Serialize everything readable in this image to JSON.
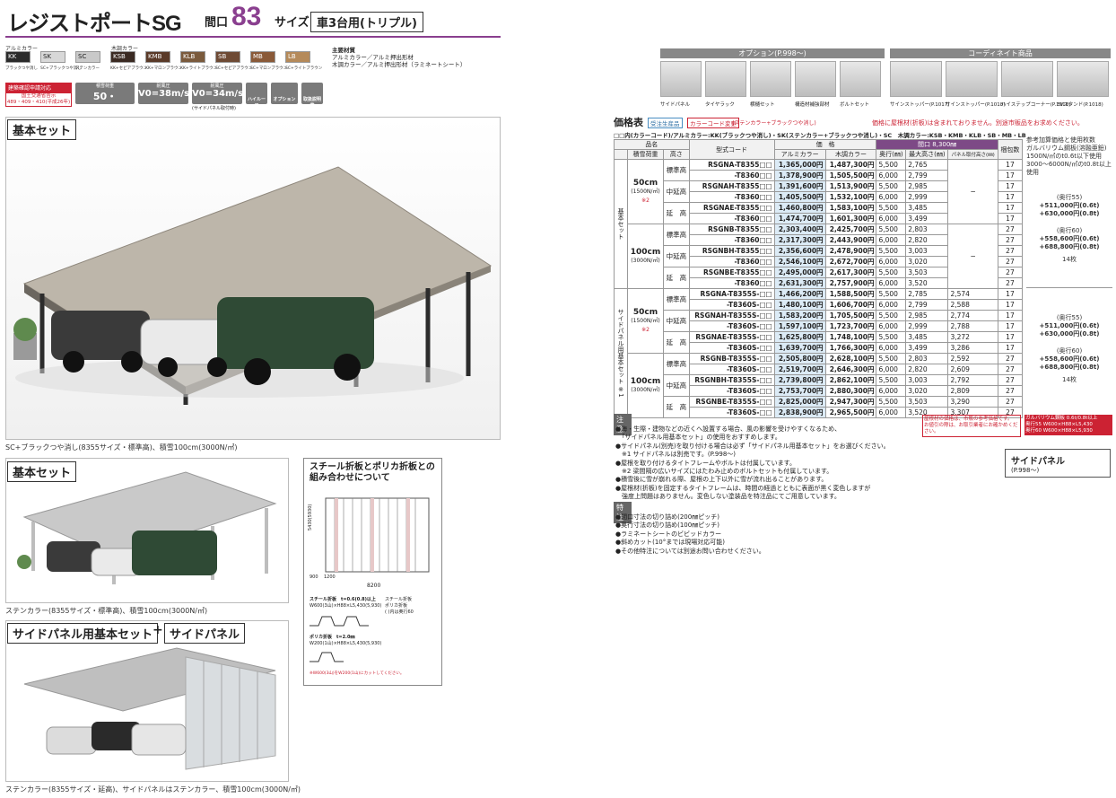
{
  "header": {
    "title": "レジストポートSG",
    "maguchi": "間口",
    "size_num": "83",
    "size_label": "サイズ",
    "type": "車3台用(トリプル)"
  },
  "colors_alumi_label": "アルミカラー",
  "colors_wood_label": "木調カラー",
  "swatches": [
    {
      "code": "KK",
      "caption": "ブラックつや消し",
      "color": "#2b2b2b",
      "text": "#ffffff"
    },
    {
      "code": "SK",
      "caption": "SC+ブラックつや消し",
      "color": "#d8d8d8",
      "text": "#222222"
    },
    {
      "code": "SC",
      "caption": "ステンカラー",
      "color": "#c9c9c9",
      "text": "#222222"
    },
    {
      "code": "KSB",
      "caption": "KK+セピアブラウン",
      "color": "#3a2a22",
      "text": "#ffffff"
    },
    {
      "code": "KMB",
      "caption": "KK+マロンブラウン",
      "color": "#5a3a28",
      "text": "#ffffff"
    },
    {
      "code": "KLB",
      "caption": "KK+ライトブラウン",
      "color": "#7a5a3c",
      "text": "#ffffff"
    },
    {
      "code": "SB",
      "caption": "SC+セピアブラウン",
      "color": "#6e4a34",
      "text": "#ffffff"
    },
    {
      "code": "MB",
      "caption": "SC+マロンブラウン",
      "color": "#8a5a38",
      "text": "#ffffff"
    },
    {
      "code": "LB",
      "caption": "SC+ライトブラウン",
      "color": "#b58a5a",
      "text": "#ffffff"
    }
  ],
  "materials": {
    "head": "主要材質",
    "line1": "アルミカラー／アルミ押出形材",
    "line2": "木調カラー／アルミ押出形材（ラミネートシート）"
  },
  "badges": {
    "red": "建築確認申請対応",
    "red_sub": "国土交通省告示",
    "red_sub2": "489・409・410(平成26年)",
    "snow_label": "積雪荷重",
    "snow": "50・100cm",
    "wind_label": "耐風圧",
    "wind1": "V0=38m/s",
    "wind2": "V0=34m/s",
    "wind_note": "(サイドパネル取付時)",
    "b_highroof": "ハイルーフ",
    "b_option": "オプション",
    "b_manual": "取扱説明書"
  },
  "left": {
    "kihon_set": "基本セット",
    "main_caption": "SC+ブラックつや消し(8355サイズ・標準高)、積雪100cm(3000N/㎡)",
    "kihon_set2": "基本セット",
    "caption2": "ステンカラー(8355サイズ・標準高)、積雪100cm(3000N/㎡)",
    "side_set": "サイドパネル用基本セット",
    "plus": "+",
    "side_panel": "サイドパネル",
    "caption3": "ステンカラー(8355サイズ・延高)、サイドパネルはステンカラー、積雪100cm(3000N/㎡)"
  },
  "steel": {
    "title1": "スチール折板とポリカ折板との",
    "title2": "組み合わせについて",
    "dim_bottom": "8200",
    "dim_small1": "900",
    "dim_small2": "1200",
    "dim_side": "5430(5930)",
    "legend1": "スチール折板",
    "legend2": "ポリカ折板",
    "legend3": "( )内は奥行60",
    "steel_spec": "スチール折板　t=0.6(0.8)以上",
    "steel_dim": "W600(3山)×H88×L5,430(5,930)",
    "poly_spec": "ポリカ折板　t=2.0㎜",
    "poly_dim": "W200(1山)×H88×L5,430(5,930)",
    "note": "※W600(3山)をW200(1山)にカットしてください。"
  },
  "options": {
    "head": "オプション(P.998〜)",
    "items": [
      "サイドパネル",
      "タイヤラック",
      "横樋セット",
      "構造材補強部材",
      "ボルトセット"
    ]
  },
  "coordinate": {
    "head": "コーディネイト商品",
    "items": [
      "サインストッパー(P.1017)",
      "サインストッパー(P.1018)",
      "ハイステップコーナー(P.1018)",
      "EVスタンド(P.1018)"
    ]
  },
  "price": {
    "head": "価格表",
    "tag1": "受注生産品",
    "tag2": "カラーコード変更",
    "tag2_note": "(ステンカラー+ブラックつや消し)",
    "note_right": "価格に屋根材(折板)は含まれておりません。別途市販品をお求めください。",
    "color_line": "□□内(カラーコード)/アルミカラー:KK(ブラックつや消し)・SK(ステンカラー+ブラックつや消し)・SC　木調カラー:KSB・KMB・KLB・SB・MB・LB",
    "h_name": "品名",
    "h_load": "積雪荷重",
    "h_height": "高さ",
    "h_code": "型式コード",
    "h_price": "価　格",
    "h_alumi": "アルミカラー",
    "h_wood": "木調カラー",
    "h_maguchi": "間口 8,300㎜",
    "h_depth": "奥行(㎜)",
    "h_maxh": "最大高さ(㎜)",
    "h_panelh": "パネル取付高さ(㎜)",
    "h_pack": "梱包数",
    "h_ref": "参考加算価格と使用枚数",
    "group1": "基本セット",
    "group2": "サイドパネル用基本セット",
    "g2_mark": "※1",
    "loads": {
      "l50": "50cm",
      "l50n": "(1500N/㎡)",
      "l50m": "※2",
      "l100": "100cm",
      "l100n": "(3000N/㎡)"
    },
    "heights": [
      "標準高",
      "中延高",
      "延　高"
    ],
    "dash": "−",
    "rows1": [
      [
        "RSGNA-T8355□□",
        "1,365,000円",
        "1,487,300円",
        "5,500",
        "2,765",
        "",
        "17"
      ],
      [
        "-T8360□□",
        "1,378,900円",
        "1,505,500円",
        "6,000",
        "2,799",
        "",
        "17"
      ],
      [
        "RSGNAH-T8355□□",
        "1,391,600円",
        "1,513,900円",
        "5,500",
        "2,985",
        "",
        "17"
      ],
      [
        "-T8360□□",
        "1,405,500円",
        "1,532,100円",
        "6,000",
        "2,999",
        "",
        "17"
      ],
      [
        "RSGNAE-T8355□□",
        "1,460,800円",
        "1,583,100円",
        "5,500",
        "3,485",
        "",
        "17"
      ],
      [
        "-T8360□□",
        "1,474,700円",
        "1,601,300円",
        "6,000",
        "3,499",
        "",
        "17"
      ],
      [
        "RSGNB-T8355□□",
        "2,303,400円",
        "2,425,700円",
        "5,500",
        "2,803",
        "",
        "27"
      ],
      [
        "-T8360□□",
        "2,317,300円",
        "2,443,900円",
        "6,000",
        "2,820",
        "",
        "27"
      ],
      [
        "RSGNBH-T8355□□",
        "2,356,600円",
        "2,478,900円",
        "5,500",
        "3,003",
        "",
        "27"
      ],
      [
        "-T8360□□",
        "2,546,100円",
        "2,672,700円",
        "6,000",
        "3,020",
        "",
        "27"
      ],
      [
        "RSGNBE-T8355□□",
        "2,495,000円",
        "2,617,300円",
        "5,500",
        "3,503",
        "",
        "27"
      ],
      [
        "-T8360□□",
        "2,631,300円",
        "2,757,900円",
        "6,000",
        "3,520",
        "",
        "27"
      ]
    ],
    "rows2": [
      [
        "RSGNA-T8355S-□□",
        "1,466,200円",
        "1,588,500円",
        "5,500",
        "2,785",
        "2,574",
        "17"
      ],
      [
        "-T8360S-□□",
        "1,480,100円",
        "1,606,700円",
        "6,000",
        "2,799",
        "2,588",
        "17"
      ],
      [
        "RSGNAH-T8355S-□□",
        "1,583,200円",
        "1,705,500円",
        "5,500",
        "2,985",
        "2,774",
        "17"
      ],
      [
        "-T8360S-□□",
        "1,597,100円",
        "1,723,700円",
        "6,000",
        "2,999",
        "2,788",
        "17"
      ],
      [
        "RSGNAE-T8355S-□□",
        "1,625,800円",
        "1,748,100円",
        "5,500",
        "3,485",
        "3,272",
        "17"
      ],
      [
        "-T8360S-□□",
        "1,639,700円",
        "1,766,300円",
        "6,000",
        "3,499",
        "3,286",
        "17"
      ],
      [
        "RSGNB-T8355S-□□",
        "2,505,800円",
        "2,628,100円",
        "5,500",
        "2,803",
        "2,592",
        "27"
      ],
      [
        "-T8360S-□□",
        "2,519,700円",
        "2,646,300円",
        "6,000",
        "2,820",
        "2,609",
        "27"
      ],
      [
        "RSGNBH-T8355S-□□",
        "2,739,800円",
        "2,862,100円",
        "5,500",
        "3,003",
        "2,792",
        "27"
      ],
      [
        "-T8360S-□□",
        "2,753,700円",
        "2,880,300円",
        "6,000",
        "3,020",
        "2,809",
        "27"
      ],
      [
        "RSGNBE-T8355S-□□",
        "2,825,000円",
        "2,947,300円",
        "5,500",
        "3,503",
        "3,290",
        "27"
      ],
      [
        "-T8360S-□□",
        "2,838,900円",
        "2,965,500円",
        "6,000",
        "3,520",
        "3,307",
        "27"
      ]
    ]
  },
  "ref": {
    "top1": "参考加算価格と使用枚数",
    "top2": "ガルバリウム鋼板(溶融亜鉛)",
    "top3": "1500N/㎡のt0.6t以下使用",
    "top4": "3000〜6000N/㎡のt0.8t以上使用",
    "a1": "(奥行55)",
    "a2": "+511,000円(0.6t)",
    "a3": "+630,000円(0.8t)",
    "a4": "(奥行60)",
    "a5": "+558,600円(0.6t)",
    "a6": "+688,800円(0.8t)",
    "a7": "14枚",
    "red_note1": "屋根材の価格は、市販の参考価格です。",
    "red_note2": "お値引の際は、お取引業者にお確かめください。",
    "red_box1": "ガルバリウム鋼板 0.6t/0.8t以上",
    "red_box2": "奥行55 W600×H88×L5,430",
    "red_box3": "奥行60 W600×H88×L5,930",
    "side_panel": "サイドパネル",
    "side_page": "(P.998〜)"
  },
  "notes": {
    "head": "注意",
    "lines": [
      "●海・生際・建物などの近くへ設置する場合、風の影響を受けやすくなるため、",
      "　「サイドパネル用基本セット」の使用をおすすめします。",
      "●サイドパネル(別売)を取り付ける場合は必ず「サイドパネル用基本セット」をお選びください。",
      "　※1 サイドパネルは別売です。(P.998〜)",
      "●屋根を取り付けるタイトフレームやボルトは付属しています。",
      "　※2 梁間隔の広いサイズにはたわみ止めのボルトセットも付属しています。",
      "●積雪後に雪が崩れる際、屋根の上下以外に雪が流れ出ることがあります。",
      "●屋根材(折板)を固定するタイトフレームは、時間の経過とともに表面が黒く変色しますが",
      "　強度上問題はありません。変色しない塗装品を特注品にてご用意しています。"
    ],
    "head2": "特注",
    "lines2": [
      "●間口寸法の切り詰め(200㎜ピッチ)",
      "●奥行寸法の切り詰め(100㎜ピッチ)",
      "●ラミネートシートのビビッドカラー",
      "●斜めカット(10°までは現場対応可能)",
      "●その他特注については別途お問い合わせください。"
    ]
  }
}
